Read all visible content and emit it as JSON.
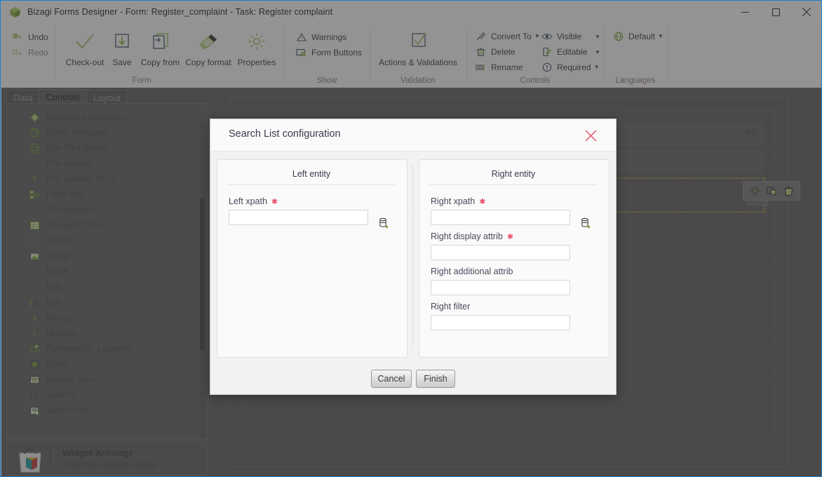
{
  "window": {
    "title": "Bizagi Forms Designer  - Form: Register_complaint - Task:  Register complaint",
    "app_icon": "bizagi-cube-icon",
    "controls": {
      "minimize": "minimize-icon",
      "maximize": "maximize-icon",
      "close": "close-icon"
    }
  },
  "ribbon": {
    "groups": [
      {
        "name": "Form",
        "label": "Form"
      },
      {
        "name": "Show",
        "label": "Show"
      },
      {
        "name": "Validation",
        "label": "Validation"
      },
      {
        "name": "Controls",
        "label": "Controls"
      },
      {
        "name": "Languages",
        "label": "Languages"
      }
    ],
    "undo": "Undo",
    "redo": "Redo",
    "checkout": "Check-out",
    "save": "Save",
    "copy_from": "Copy from",
    "copy_format": "Copy format",
    "properties": "Properties",
    "warnings": "Warnings",
    "form_buttons": "Form Buttons",
    "actions_validations": "Actions & Validations",
    "convert_to": "Convert To",
    "delete": "Delete",
    "rename": "Rename",
    "visible": "Visible",
    "editable": "Editable",
    "required": "Required",
    "default": "Default"
  },
  "left_panel": {
    "tabs": [
      {
        "label": "Data",
        "active": false
      },
      {
        "label": "Controls",
        "active": true
      },
      {
        "label": "Layout",
        "active": false
      }
    ],
    "controls": [
      {
        "label": "Document templates",
        "icon": "document-templates-icon"
      },
      {
        "label": "Entity Template",
        "icon": "entity-template-icon"
      },
      {
        "label": "File Print Button",
        "icon": "file-print-icon"
      },
      {
        "label": "File uploads",
        "icon": "paperclip-icon"
      },
      {
        "label": "File uploads ECM",
        "icon": "upload-box-icon"
      },
      {
        "label": "Form link",
        "icon": "form-link-icon"
      },
      {
        "label": "Geolocation",
        "icon": "geolocation-icon"
      },
      {
        "label": "Grouped Table",
        "icon": "grouped-table-icon"
      },
      {
        "label": "Hidden",
        "icon": "hidden-icon"
      },
      {
        "label": "Image",
        "icon": "image-icon"
      },
      {
        "label": "Label",
        "icon": "label-tag-icon"
      },
      {
        "label": "Link",
        "icon": "link-chain-icon"
      },
      {
        "label": "List",
        "icon": "list-icon"
      },
      {
        "label": "Money",
        "icon": "money-icon"
      },
      {
        "label": "Number",
        "icon": "number-icon"
      },
      {
        "label": "Polymorphic Launcher",
        "icon": "polymorphic-launcher-icon"
      },
      {
        "label": "Radio",
        "icon": "radio-icon"
      },
      {
        "label": "Record view",
        "icon": "record-view-icon"
      },
      {
        "label": "Search",
        "icon": "search-icon"
      },
      {
        "label": "SearchList",
        "icon": "searchlist-icon"
      }
    ],
    "widget_xchange": {
      "title": "Widget Xchange",
      "subtitle": "Find more widgets online",
      "icon": "widget-bag-icon"
    }
  },
  "canvas": {
    "selection_toolbar": [
      {
        "name": "configure",
        "icon": "gear-icon"
      },
      {
        "name": "duplicate",
        "icon": "copy-icon"
      },
      {
        "name": "delete",
        "icon": "trash-icon"
      }
    ],
    "calendar_icon": "calendar-icon",
    "selected_control_icon": "search-magnifier-icon"
  },
  "modal": {
    "title": "Search List configuration",
    "close_icon": "close-icon",
    "left_panel": {
      "header": "Left entity",
      "fields": [
        {
          "label": "Left xpath",
          "required": true,
          "value": "",
          "picker_icon": "database-add-icon"
        }
      ]
    },
    "right_panel": {
      "header": "Right entity",
      "fields": [
        {
          "label": "Right xpath",
          "required": true,
          "value": "",
          "picker_icon": "database-add-icon"
        },
        {
          "label": "Right display attrib",
          "required": true,
          "value": ""
        },
        {
          "label": "Right additional attrib",
          "required": false,
          "value": ""
        },
        {
          "label": "Right filter",
          "required": false,
          "value": ""
        }
      ]
    },
    "buttons": {
      "cancel": "Cancel",
      "finish": "Finish"
    }
  },
  "colors": {
    "accent": "#1a7fd4",
    "green": "#8cb63c",
    "required_red": "#e8536b",
    "group_label": "#8d6e8d",
    "selection": "#c8a53c"
  }
}
